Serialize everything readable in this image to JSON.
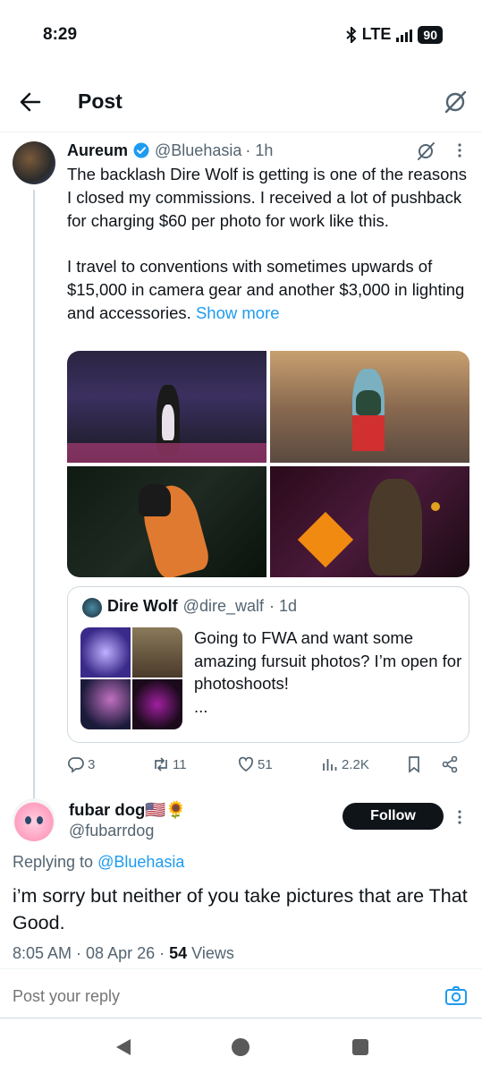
{
  "status_bar": {
    "time": "8:29",
    "network": "LTE",
    "battery": "90"
  },
  "header": {
    "title": "Post",
    "back_icon": "arrow-left-icon",
    "grok_icon": "grok-icon"
  },
  "tweet": {
    "author": "Aureum",
    "handle": "@Bluehasia",
    "time": "· 1h",
    "verified": true,
    "text_p1": "The backlash Dire Wolf is getting is one of the reasons I closed my commissions. I received a lot of pushback for charging $60 per photo for work like this.",
    "text_p2": "I travel to conventions with sometimes upwards of $15,000 in camera gear and another $3,000 in lighting and accessories.",
    "show_more": "Show more",
    "photo_count": 4,
    "quote": {
      "author": "Dire Wolf",
      "handle": "@dire_walf",
      "time": "· 1d",
      "text": "Going to FWA and want some amazing fursuit photos? I’m open for photoshoots!",
      "ellipsis": "..."
    },
    "actions": {
      "replies": "3",
      "reposts": "11",
      "likes": "51",
      "views": "2.2K"
    }
  },
  "reply": {
    "author": "fubar dog🇺🇸🌻",
    "handle": "@fubarrdog",
    "follow_label": "Follow",
    "replying_prefix": "Replying to ",
    "replying_to": "@Bluehasia",
    "text": "i’m sorry but neither of you take pictures that are That Good.",
    "time": "8:05 AM",
    "date": "08 Apr 26",
    "views_count": "54",
    "views_label": "Views"
  },
  "reply_bar": {
    "placeholder": "Post your reply"
  },
  "colors": {
    "accent": "#1d9bf0",
    "text": "#0f1419",
    "muted": "#536471",
    "border": "#cfd9de"
  }
}
